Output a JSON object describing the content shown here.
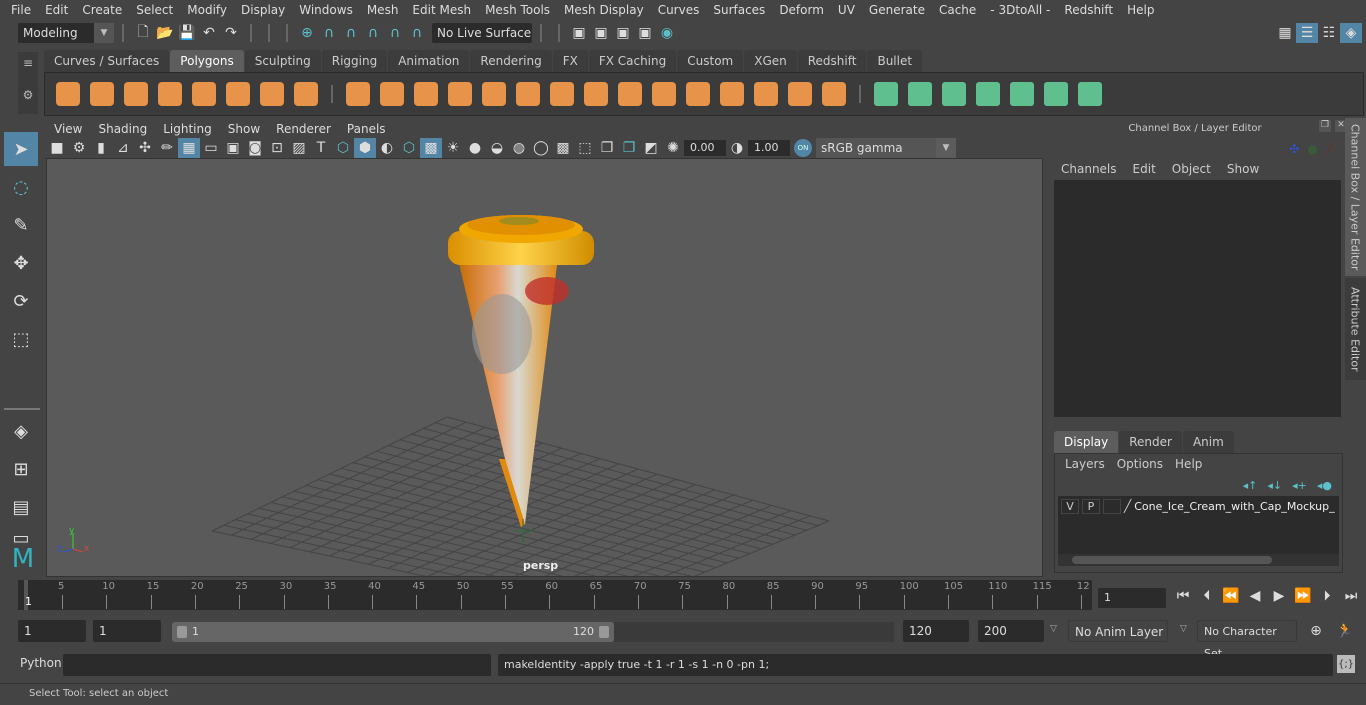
{
  "menubar": {
    "items": [
      "File",
      "Edit",
      "Create",
      "Select",
      "Modify",
      "Display",
      "Windows",
      "Mesh",
      "Edit Mesh",
      "Mesh Tools",
      "Mesh Display",
      "Curves",
      "Surfaces",
      "Deform",
      "UV",
      "Generate",
      "Cache",
      "- 3DtoAll -",
      "Redshift",
      "Help"
    ]
  },
  "statusline": {
    "mode": "Modeling",
    "live_surface": "No Live Surface"
  },
  "shelf": {
    "tabs": [
      "Curves / Surfaces",
      "Polygons",
      "Sculpting",
      "Rigging",
      "Animation",
      "Rendering",
      "FX",
      "FX Caching",
      "Custom",
      "XGen",
      "Redshift",
      "Bullet"
    ],
    "active_tab": "Polygons",
    "orange_icons": [
      "poly-sphere-icon",
      "poly-cube-icon",
      "poly-cylinder-icon",
      "poly-cone-icon",
      "poly-plane-icon",
      "poly-torus-icon",
      "poly-pyramid-icon",
      "poly-pipe-icon",
      "combine-icon",
      "separate-icon",
      "mirror-icon",
      "smooth-icon",
      "bevel-icon",
      "extract-icon",
      "multi-cut-icon",
      "extrude-icon",
      "bridge-icon",
      "cube-face-icon",
      "insert-edge-loop-icon",
      "offset-edge-loop-icon",
      "append-polygon-icon",
      "fill-hole-icon",
      "merge-icon"
    ],
    "green_icons": [
      "planar-uv-icon",
      "cylindrical-uv-icon",
      "spherical-uv-icon",
      "automatic-uv-icon",
      "unfold-uv-icon",
      "uv-editor-icon",
      "cut-sew-uv-icon"
    ]
  },
  "viewport": {
    "menu": [
      "View",
      "Shading",
      "Lighting",
      "Show",
      "Renderer",
      "Panels"
    ],
    "exposure": "0.00",
    "gamma": "1.00",
    "color_mgmt_badge": "ON",
    "color_space": "sRGB gamma",
    "camera_label": "persp",
    "axis": {
      "x": "x",
      "y": "y",
      "z": "z"
    }
  },
  "right_panel": {
    "title": "Channel Box / Layer Editor",
    "channel_menu": [
      "Channels",
      "Edit",
      "Object",
      "Show"
    ],
    "layer_tabs": [
      "Display",
      "Render",
      "Anim"
    ],
    "active_layer_tab": "Display",
    "layer_menu": [
      "Layers",
      "Options",
      "Help"
    ],
    "layers": [
      {
        "v": "V",
        "p": "P",
        "name": "Cone_Ice_Cream_with_Cap_Mockup_"
      }
    ],
    "side_tabs": [
      "Channel Box / Layer Editor",
      "Attribute Editor"
    ]
  },
  "timeline": {
    "ticks": [
      "5",
      "10",
      "15",
      "20",
      "25",
      "30",
      "35",
      "40",
      "45",
      "50",
      "55",
      "60",
      "65",
      "70",
      "75",
      "80",
      "85",
      "90",
      "95",
      "100",
      "105",
      "110",
      "115",
      "12"
    ],
    "current_frame_marker": "1",
    "current_frame": "1"
  },
  "range": {
    "start": "1",
    "anim_start": "1",
    "slider_min_label": "1",
    "slider_max_label": "120",
    "end": "120",
    "anim_end": "200",
    "anim_layer": "No Anim Layer",
    "character_set": "No Character Set"
  },
  "command": {
    "lang": "Python",
    "input": "",
    "result": "makeIdentity -apply true -t 1 -r 1 -s 1 -n 0 -pn 1;"
  },
  "help_line": "Select Tool: select an object",
  "colors": {
    "accent": "#5285a6",
    "shelf_orange": "#e8934a",
    "shelf_green": "#5fbf8e",
    "viewport_bg": "#5a5a5a"
  }
}
